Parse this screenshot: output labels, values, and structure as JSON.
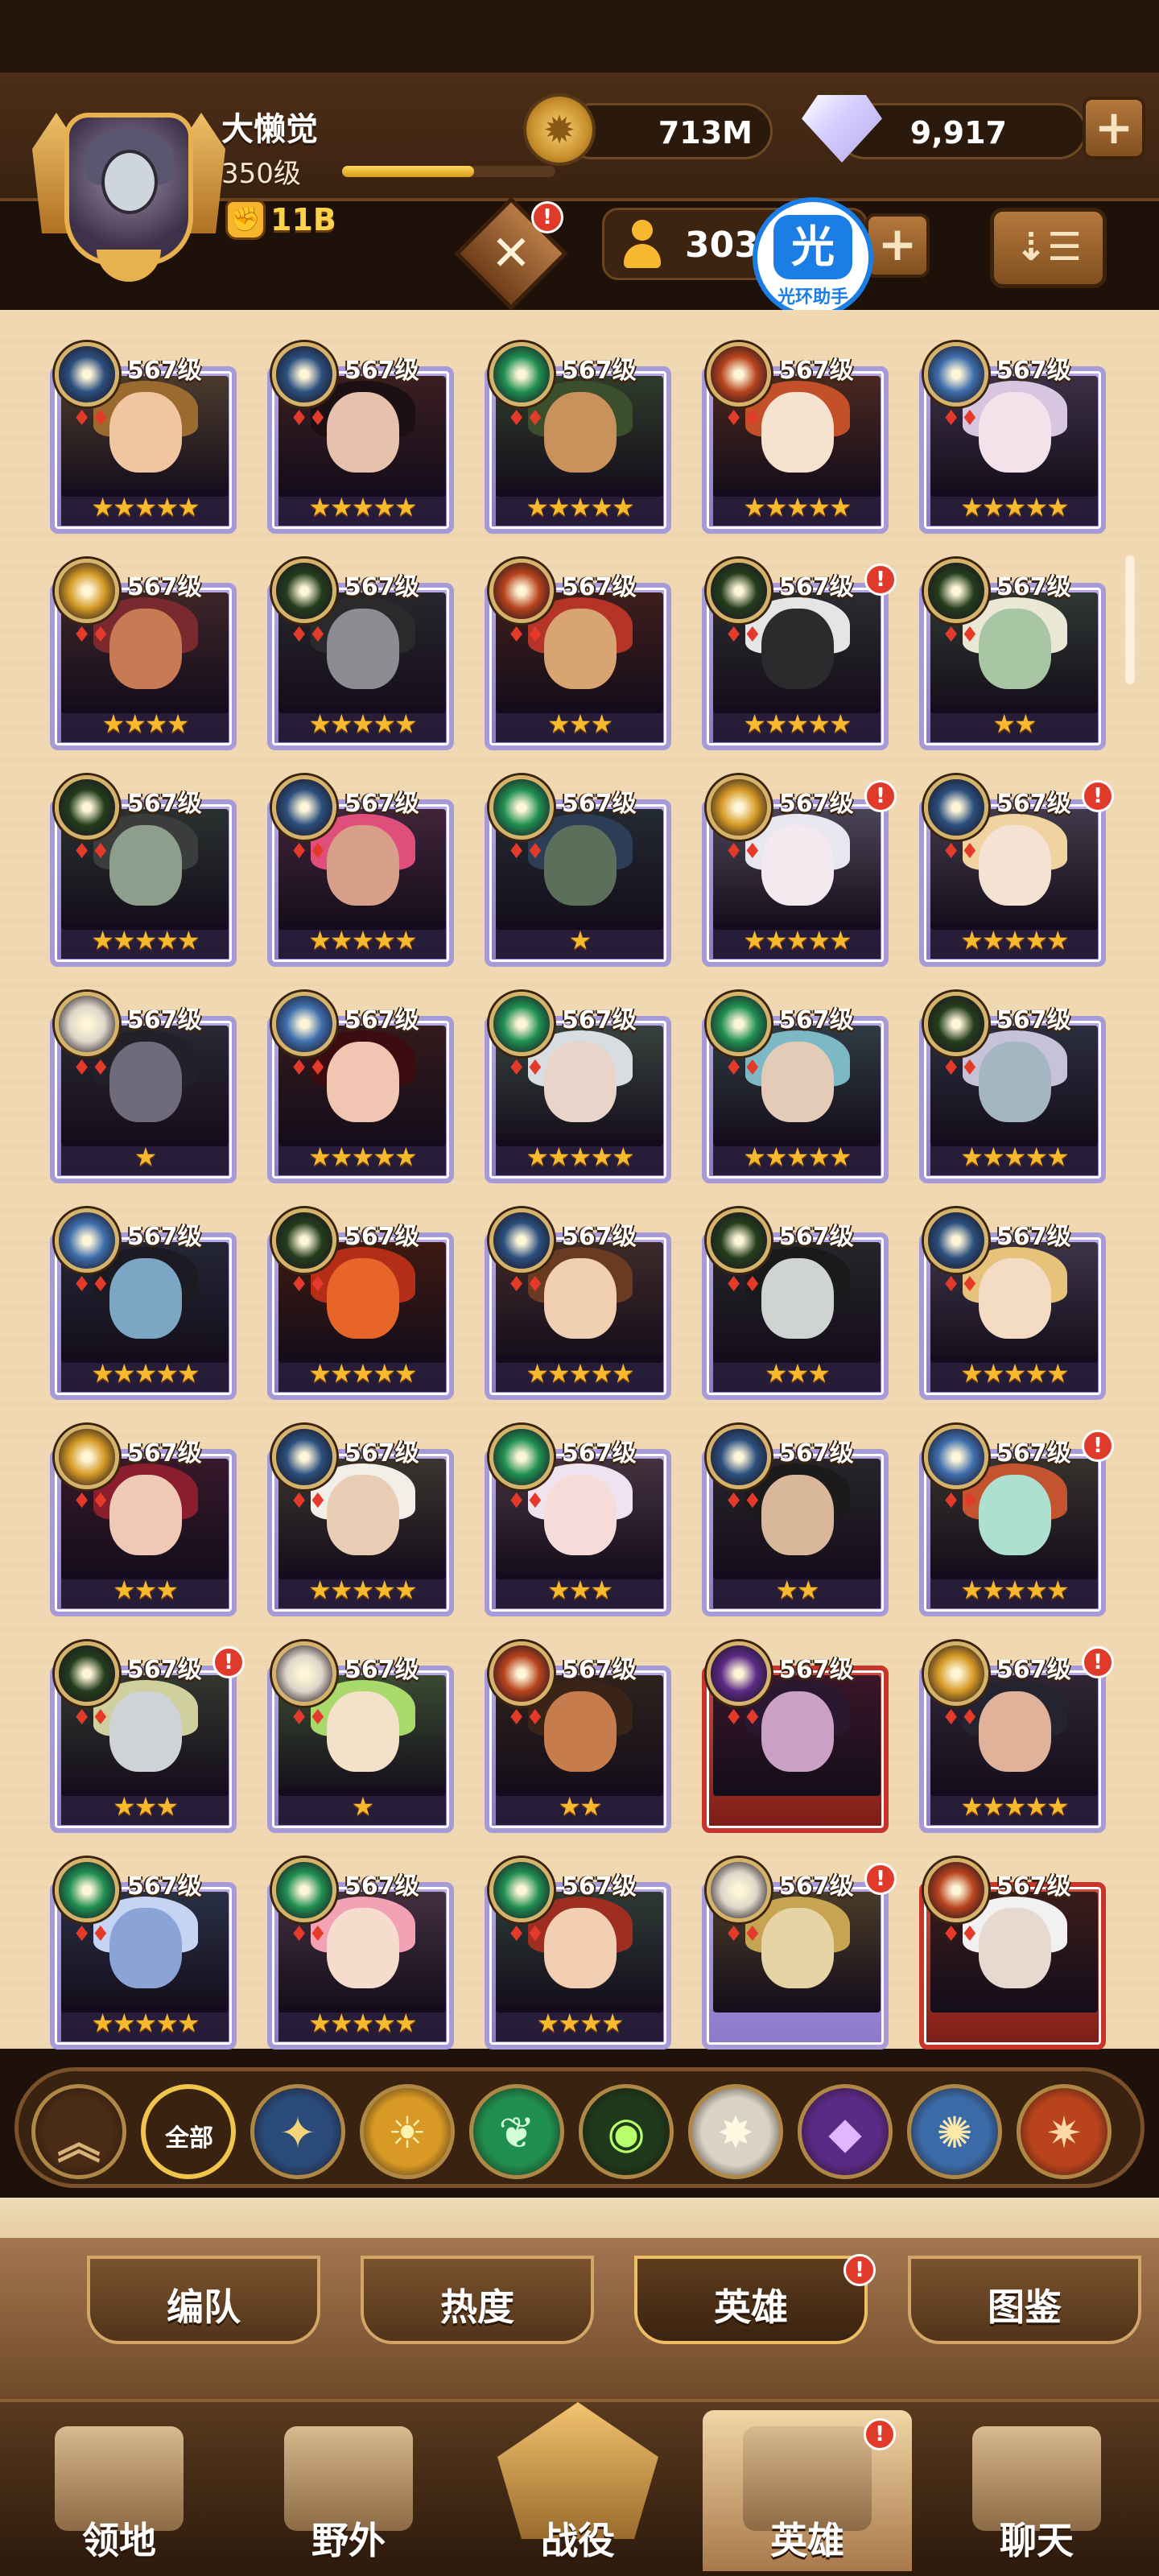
{
  "player": {
    "name": "大懒觉",
    "level": "350级",
    "xp_fraction": 0.62,
    "power": "11B"
  },
  "resources": {
    "gold": "713M",
    "gems": "9,917",
    "hero_count": "303"
  },
  "watermark": {
    "icon_text": "光",
    "label": "光环助手"
  },
  "icons": {
    "plus": "+",
    "sort": "⇣☰",
    "summon": "✕"
  },
  "level_label": "567级",
  "heroes": [
    {
      "faction": "celestial",
      "stars": "★★★★★",
      "alert": false,
      "hair": "#9a6a2f",
      "skin": "#f0c6a0",
      "bg": "#4b3b2d"
    },
    {
      "faction": "celestial",
      "stars": "★★★★★",
      "alert": false,
      "hair": "#1d1014",
      "skin": "#e6c1ae",
      "bg": "#3b1e22"
    },
    {
      "faction": "wilder",
      "stars": "★★★★★",
      "alert": false,
      "hair": "#3b4f2c",
      "skin": "#c9925d",
      "bg": "#2f3b2b"
    },
    {
      "faction": "graveborn-red",
      "stars": "★★★★★",
      "alert": false,
      "hair": "#c4502a",
      "skin": "#f5e3d0",
      "bg": "#4a2820"
    },
    {
      "faction": "celestial-blue",
      "stars": "★★★★★",
      "alert": false,
      "hair": "#d8c5e0",
      "skin": "#f3e2e9",
      "bg": "#3c2f46"
    },
    {
      "faction": "lightbearer",
      "stars": "★★★★",
      "alert": false,
      "hair": "#7a2a2e",
      "skin": "#c87a55",
      "bg": "#3d2529"
    },
    {
      "faction": "mauler",
      "stars": "★★★★★",
      "alert": false,
      "hair": "#2a2a2d",
      "skin": "#8b8d92",
      "bg": "#28262c"
    },
    {
      "faction": "graveborn-red",
      "stars": "★★★",
      "alert": false,
      "hair": "#b43427",
      "skin": "#d7a472",
      "bg": "#3e1e1c"
    },
    {
      "faction": "mauler",
      "stars": "★★★★★",
      "alert": true,
      "hair": "#e5e5e5",
      "skin": "#2b2b2d",
      "bg": "#2b2c2f"
    },
    {
      "faction": "mauler",
      "stars": "★★",
      "alert": false,
      "hair": "#eae8d5",
      "skin": "#a8c6a3",
      "bg": "#2f3833"
    },
    {
      "faction": "mauler",
      "stars": "★★★★★",
      "alert": false,
      "hair": "#3a3d3c",
      "skin": "#8d9e8c",
      "bg": "#2a3130"
    },
    {
      "faction": "celestial",
      "stars": "★★★★★",
      "alert": false,
      "hair": "#e04f7c",
      "skin": "#d8a08a",
      "bg": "#41243a"
    },
    {
      "faction": "wilder",
      "stars": "★",
      "alert": false,
      "hair": "#2c3e56",
      "skin": "#5b6f5b",
      "bg": "#232a33"
    },
    {
      "faction": "lightbearer",
      "stars": "★★★★★",
      "alert": true,
      "hair": "#e8e6ef",
      "skin": "#f4e9ee",
      "bg": "#4a4556"
    },
    {
      "faction": "celestial",
      "stars": "★★★★★",
      "alert": true,
      "hair": "#f1d3a1",
      "skin": "#f4e2d3",
      "bg": "#413a4a"
    },
    {
      "faction": "lightbearer-white",
      "stars": "★",
      "alert": false,
      "hair": "#222028",
      "skin": "#6f6a7c",
      "bg": "#2a2832"
    },
    {
      "faction": "celestial-blue",
      "stars": "★★★★★",
      "alert": false,
      "hair": "#3b0d10",
      "skin": "#f0c5b1",
      "bg": "#331a1d"
    },
    {
      "faction": "wilder",
      "stars": "★★★★★",
      "alert": false,
      "hair": "#d8dde2",
      "skin": "#e8d4c8",
      "bg": "#37413d"
    },
    {
      "faction": "wilder",
      "stars": "★★★★★",
      "alert": false,
      "hair": "#7db8c5",
      "skin": "#e4cbb8",
      "bg": "#2f3b43"
    },
    {
      "faction": "mauler",
      "stars": "★★★★★",
      "alert": false,
      "hair": "#c6c3d8",
      "skin": "#a3b6c2",
      "bg": "#2c2e3e"
    },
    {
      "faction": "celestial-blue",
      "stars": "★★★★★",
      "alert": false,
      "hair": "#1c1a22",
      "skin": "#7ca6c4",
      "bg": "#242637"
    },
    {
      "faction": "mauler",
      "stars": "★★★★★",
      "alert": false,
      "hair": "#b42d17",
      "skin": "#e8652a",
      "bg": "#3e1a12"
    },
    {
      "faction": "celestial",
      "stars": "★★★★★",
      "alert": false,
      "hair": "#6a3a22",
      "skin": "#f1cfb3",
      "bg": "#3e2a2a"
    },
    {
      "faction": "mauler",
      "stars": "★★★",
      "alert": false,
      "hair": "#1a1a1d",
      "skin": "#cfd3d1",
      "bg": "#262629"
    },
    {
      "faction": "celestial",
      "stars": "★★★★★",
      "alert": false,
      "hair": "#e6c27a",
      "skin": "#f3dcc3",
      "bg": "#3b3548"
    },
    {
      "faction": "lightbearer",
      "stars": "★★★",
      "alert": false,
      "hair": "#8a1e2c",
      "skin": "#f0c9b6",
      "bg": "#37192a"
    },
    {
      "faction": "celestial",
      "stars": "★★★★★",
      "alert": false,
      "hair": "#f2efe9",
      "skin": "#e9cdb4",
      "bg": "#3a3530"
    },
    {
      "faction": "wilder",
      "stars": "★★★",
      "alert": false,
      "hair": "#efe3ef",
      "skin": "#f6dcd9",
      "bg": "#45323f"
    },
    {
      "faction": "celestial",
      "stars": "★★",
      "alert": false,
      "hair": "#1c1a1b",
      "skin": "#d9b79b",
      "bg": "#27252a"
    },
    {
      "faction": "celestial-blue",
      "stars": "★★★★★",
      "alert": true,
      "hair": "#c4532f",
      "skin": "#aee0cf",
      "bg": "#35322e"
    },
    {
      "faction": "mauler",
      "stars": "★★★",
      "alert": true,
      "hair": "#d0cf9e",
      "skin": "#cfd3d6",
      "bg": "#33362f"
    },
    {
      "faction": "lightbearer-white",
      "stars": "★",
      "alert": false,
      "hair": "#a9d86b",
      "skin": "#f3e2c9",
      "bg": "#3a4a32"
    },
    {
      "faction": "graveborn-red",
      "stars": "★★",
      "alert": false,
      "hair": "#3a2418",
      "skin": "#c67c4d",
      "bg": "#2e221d"
    },
    {
      "faction": "hypogean",
      "stars": "",
      "alert": false,
      "red": true,
      "hair": "#2a1730",
      "skin": "#caa0c5",
      "bg": "#3a1628"
    },
    {
      "faction": "lightbearer",
      "stars": "★★★★★",
      "alert": true,
      "hair": "#232430",
      "skin": "#e0b29a",
      "bg": "#2f2536"
    },
    {
      "faction": "wilder",
      "stars": "★★★★★",
      "alert": false,
      "hair": "#c6d4f4",
      "skin": "#8aa4d8",
      "bg": "#2a3045"
    },
    {
      "faction": "wilder",
      "stars": "★★★★★",
      "alert": false,
      "hair": "#f3a2b6",
      "skin": "#f6dccc",
      "bg": "#433040"
    },
    {
      "faction": "wilder",
      "stars": "★★★★",
      "alert": false,
      "hair": "#9e2e22",
      "skin": "#f2cfb2",
      "bg": "#2d3a36"
    },
    {
      "faction": "lightbearer-white",
      "stars": "",
      "alert": true,
      "hair": "#c7a451",
      "skin": "#e6d4a7",
      "bg": "#4a3c29"
    },
    {
      "faction": "graveborn-red",
      "stars": "",
      "alert": false,
      "red": true,
      "hair": "#f1f1f1",
      "skin": "#e7d9cf",
      "bg": "#3b1d1a"
    }
  ],
  "filters": [
    {
      "key": "up",
      "glyph": "︽",
      "color": "#d9b27a",
      "bg": "#4a2c16"
    },
    {
      "key": "all",
      "label": "全部"
    },
    {
      "key": "celestial",
      "glyph": "✦",
      "color": "#f5d37a",
      "bg": "#2a4a7a"
    },
    {
      "key": "lightbearer",
      "glyph": "☀",
      "color": "#fff1b0",
      "bg": "#d89a24"
    },
    {
      "key": "wilder",
      "glyph": "❦",
      "color": "#d2ffd6",
      "bg": "#1f8e4f"
    },
    {
      "key": "mauler",
      "glyph": "◉",
      "color": "#b7ff6b",
      "bg": "#1e3a1a"
    },
    {
      "key": "lightbearer-white",
      "glyph": "✸",
      "color": "#fff8e0",
      "bg": "#d9d3c6"
    },
    {
      "key": "hypogean",
      "glyph": "◆",
      "color": "#e2b6ff",
      "bg": "#5b2a86"
    },
    {
      "key": "celestial-blue",
      "glyph": "✺",
      "color": "#ffe9a8",
      "bg": "#3b6aa8"
    },
    {
      "key": "graveborn-red",
      "glyph": "✷",
      "color": "#ffd8a8",
      "bg": "#b9441c"
    }
  ],
  "tabs": [
    {
      "label": "编队",
      "active": false,
      "alert": false
    },
    {
      "label": "热度",
      "active": false,
      "alert": false
    },
    {
      "label": "英雄",
      "active": true,
      "alert": true
    },
    {
      "label": "图鉴",
      "active": false,
      "alert": false
    }
  ],
  "nav": [
    {
      "label": "领地",
      "active": false,
      "alert": false
    },
    {
      "label": "野外",
      "active": false,
      "alert": false
    },
    {
      "label": "战役",
      "active": false,
      "alert": false,
      "center": true
    },
    {
      "label": "英雄",
      "active": true,
      "alert": true
    },
    {
      "label": "聊天",
      "active": false,
      "alert": false
    }
  ],
  "faction_colors": {
    "celestial": "#2b4f7e",
    "celestial-blue": "#3d6eac",
    "lightbearer": "#d59a25",
    "wilder": "#1f8f52",
    "mauler": "#233d1c",
    "lightbearer-white": "#ddd6c8",
    "graveborn-red": "#b8431d",
    "hypogean": "#5b2a86"
  }
}
